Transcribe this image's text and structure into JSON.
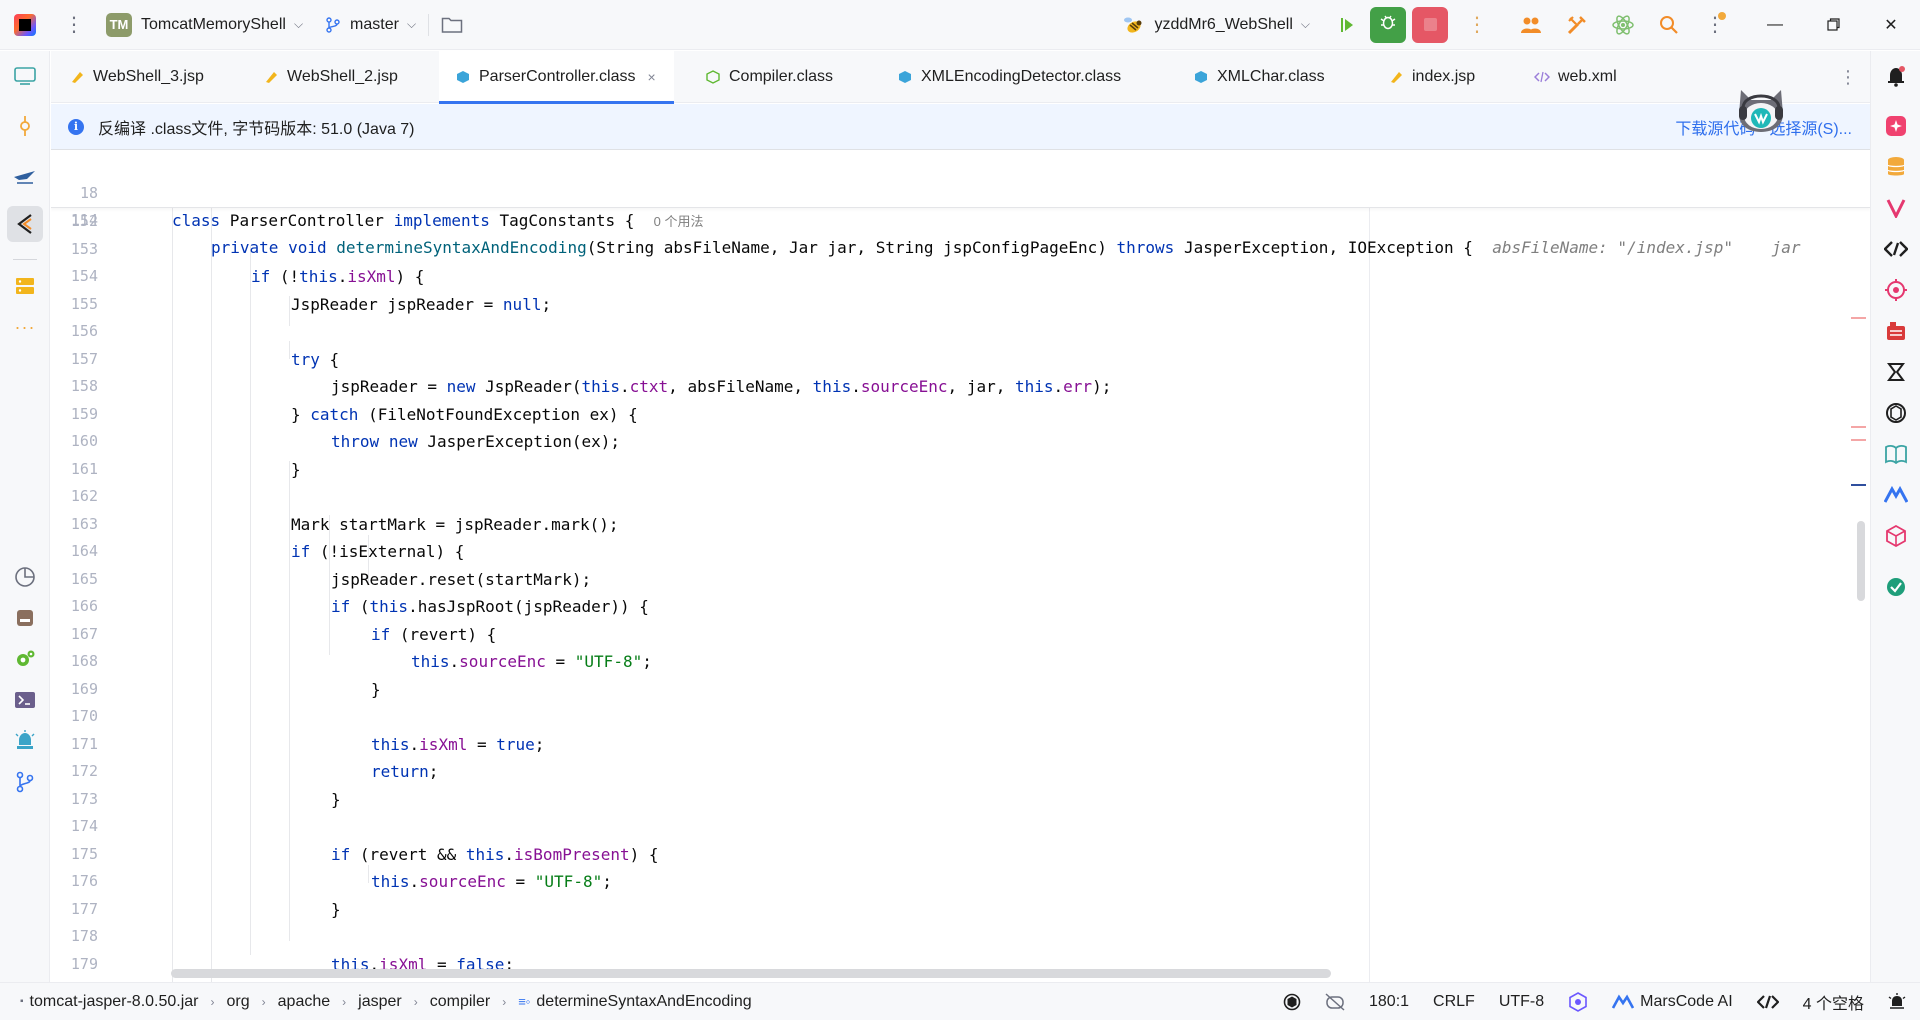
{
  "titlebar": {
    "project_initials": "TM",
    "project_name": "TomcatMemoryShell",
    "branch": "master",
    "run_config": "yzddMr6_WebShell"
  },
  "tabs": [
    {
      "label": "WebShell_3.jsp",
      "icon": "jsp-file-icon"
    },
    {
      "label": "WebShell_2.jsp",
      "icon": "jsp-file-icon"
    },
    {
      "label": "ParserController.class",
      "icon": "class-file-icon",
      "active": true,
      "close": "×"
    },
    {
      "label": "Compiler.class",
      "icon": "class-file-icon"
    },
    {
      "label": "XMLEncodingDetector.class",
      "icon": "class-file-icon"
    },
    {
      "label": "XMLChar.class",
      "icon": "class-file-icon"
    },
    {
      "label": "index.jsp",
      "icon": "jsp-file-icon"
    },
    {
      "label": "web.xml",
      "icon": "xml-file-icon"
    }
  ],
  "banner": {
    "info_glyph": "i",
    "text": "反编译 .class文件, 字节码版本: 51.0 (Java 7)",
    "link_download": "下载源代码",
    "link_choose": "选择源(S)..."
  },
  "sticky": {
    "l1_num": "18",
    "l1_kw1": "class",
    "l1_name": " ParserController ",
    "l1_kw2": "implements",
    "l1_rest": " TagConstants {",
    "l1_hint": "0 个用法",
    "l2_num": "114",
    "l2_kw1": "private",
    "l2_kw2": "void",
    "l2_method": "determineSyntaxAndEncoding",
    "l2_params": "(String absFileName, Jar jar, String jspConfigPageEnc) ",
    "l2_kw3": "throws",
    "l2_rest": " JasperException, IOException {",
    "l2_inlay1": "absFileName: \"/index.jsp\"",
    "l2_inlay2": "jar"
  },
  "code": {
    "n152": "152",
    "n153": "153",
    "c153a": "if",
    "c153b": " (!",
    "c153c": "this",
    "c153d": ".",
    "c153e": "isXml",
    "c153f": ") {",
    "n154": "154",
    "c154a": "JspReader jspReader = ",
    "c154b": "null",
    "c154c": ";",
    "n155": "155",
    "n156": "156",
    "c156a": "try",
    "c156b": " {",
    "n157": "157",
    "c157a": "jspReader = ",
    "c157b": "new",
    "c157c": " JspReader(",
    "c157d": "this",
    "c157e": ".",
    "c157f": "ctxt",
    "c157g": ", absFileName, ",
    "c157h": "this",
    "c157i": ".",
    "c157j": "sourceEnc",
    "c157k": ", jar, ",
    "c157l": "this",
    "c157m": ".",
    "c157n": "err",
    "c157o": ");",
    "n158": "158",
    "c158a": "} ",
    "c158b": "catch",
    "c158c": " (FileNotFoundException ex) {",
    "n159": "159",
    "c159a": "throw",
    "c159b": " ",
    "c159c": "new",
    "c159d": " JasperException(ex);",
    "n160": "160",
    "c160": "}",
    "n161": "161",
    "n162": "162",
    "c162": "Mark startMark = jspReader.mark();",
    "n163": "163",
    "c163a": "if",
    "c163b": " (!isExternal) {",
    "n164": "164",
    "c164": "jspReader.reset(startMark);",
    "n165": "165",
    "c165a": "if",
    "c165b": " (",
    "c165c": "this",
    "c165d": ".hasJspRoot(jspReader)) {",
    "n166": "166",
    "c166a": "if",
    "c166b": " (revert) {",
    "n167": "167",
    "c167a": "this",
    "c167b": ".",
    "c167c": "sourceEnc",
    "c167d": " = ",
    "c167e": "\"UTF-8\"",
    "c167f": ";",
    "n168": "168",
    "c168": "}",
    "n169": "169",
    "n170": "170",
    "c170a": "this",
    "c170b": ".",
    "c170c": "isXml",
    "c170d": " = ",
    "c170e": "true",
    "c170f": ";",
    "n171": "171",
    "c171a": "return",
    "c171b": ";",
    "n172": "172",
    "c172": "}",
    "n173": "173",
    "n174": "174",
    "c174a": "if",
    "c174b": " (revert && ",
    "c174c": "this",
    "c174d": ".",
    "c174e": "isBomPresent",
    "c174f": ") {",
    "n175": "175",
    "c175a": "this",
    "c175b": ".",
    "c175c": "sourceEnc",
    "c175d": " = ",
    "c175e": "\"UTF-8\"",
    "c175f": ";",
    "n176": "176",
    "c176": "}",
    "n177": "177",
    "n178": "178",
    "c178a": "this",
    "c178b": ".",
    "c178c": "isXml",
    "c178d": " = ",
    "c178e": "false",
    "c178f": ";",
    "n179": "179",
    "c179": "}"
  },
  "statusbar": {
    "crumbs": [
      "tomcat-jasper-8.0.50.jar",
      "org",
      "apache",
      "jasper",
      "compiler",
      "determineSyntaxAndEncoding"
    ],
    "position": "180:1",
    "line_sep": "CRLF",
    "encoding": "UTF-8",
    "ai": "MarsCode AI",
    "indent": "4 个空格"
  },
  "colors": {
    "accent": "#3574f0",
    "keyword": "#0033b3",
    "field": "#871094",
    "string": "#067d17",
    "debug_green": "#43a047",
    "stop_red": "#e55765"
  }
}
